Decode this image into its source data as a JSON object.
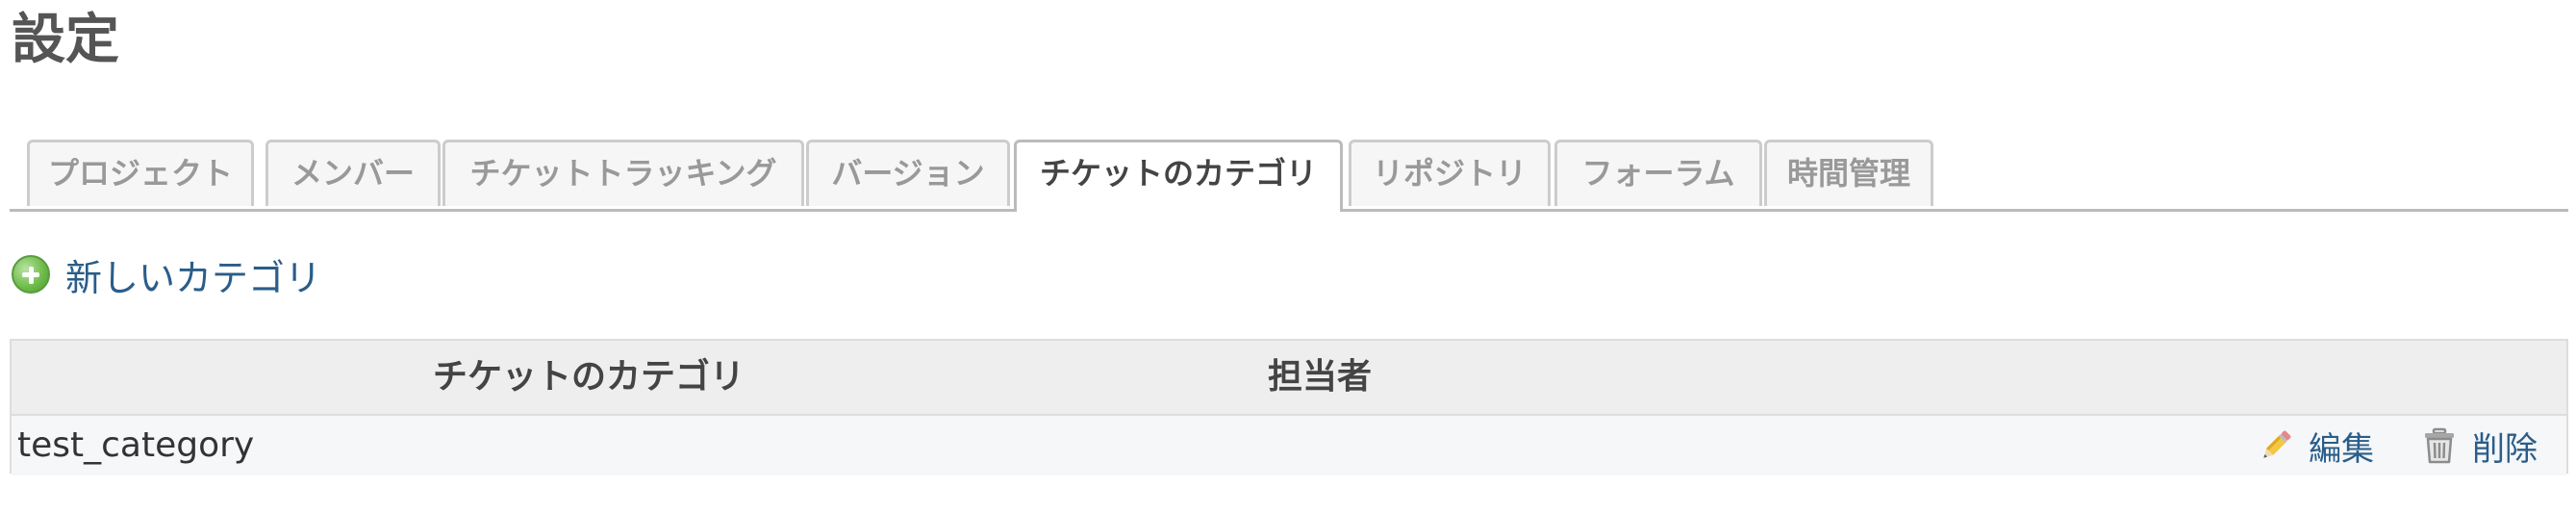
{
  "page": {
    "title": "設定"
  },
  "tabs": [
    {
      "label": "プロジェクト",
      "active": false
    },
    {
      "label": "メンバー",
      "active": false
    },
    {
      "label": "チケットトラッキング",
      "active": false
    },
    {
      "label": "バージョン",
      "active": false
    },
    {
      "label": "チケットのカテゴリ",
      "active": true
    },
    {
      "label": "リポジトリ",
      "active": false
    },
    {
      "label": "フォーラム",
      "active": false
    },
    {
      "label": "時間管理",
      "active": false
    }
  ],
  "new_category": {
    "icon": "add-icon",
    "label": "新しいカテゴリ"
  },
  "table": {
    "headers": {
      "category": "チケットのカテゴリ",
      "assignee": "担当者"
    },
    "rows": [
      {
        "name": "test_category",
        "assignee": "",
        "edit_label": "編集",
        "delete_label": "削除"
      }
    ]
  },
  "colors": {
    "link": "#2a5d8a",
    "active_tab_text": "#444444",
    "inactive_tab_text": "#999999",
    "table_header_bg": "#eeeeee",
    "add_icon": "#6fbd4c"
  }
}
